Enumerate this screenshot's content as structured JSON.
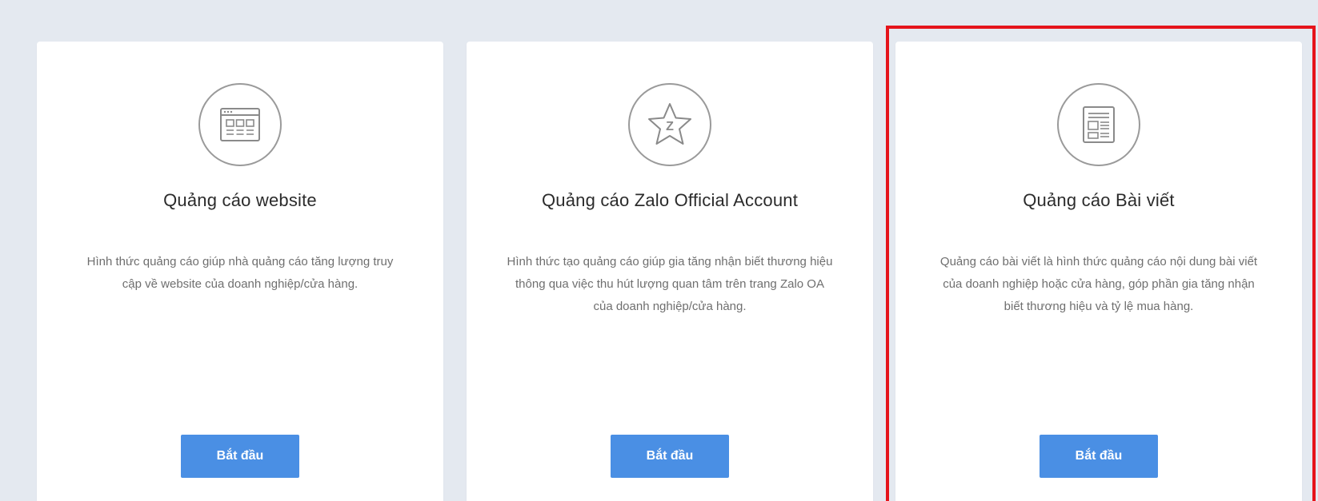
{
  "colors": {
    "page_background": "#e4e9f0",
    "card_background": "#ffffff",
    "button": "#4a8fe4",
    "highlight": "#e5141b"
  },
  "cards": [
    {
      "icon": "website-grid-icon",
      "title": "Quảng cáo website",
      "description": "Hình thức quảng cáo giúp nhà quảng cáo tăng lượng truy cập về website của doanh nghiệp/cửa hàng.",
      "button_label": "Bắt đầu"
    },
    {
      "icon": "zalo-star-icon",
      "icon_letter": "Z",
      "title": "Quảng cáo Zalo Official Account",
      "description": "Hình thức tạo quảng cáo giúp gia tăng nhận biết thương hiệu thông qua việc thu hút lượng quan tâm trên trang Zalo OA của doanh nghiệp/cửa hàng.",
      "button_label": "Bắt đầu"
    },
    {
      "icon": "article-newspaper-icon",
      "title": "Quảng cáo Bài viết",
      "description": "Quảng cáo bài viết là hình thức quảng cáo nội dung bài viết của doanh nghiệp hoặc cửa hàng, góp phần gia tăng nhận biết thương hiệu và tỷ lệ mua hàng.",
      "button_label": "Bắt đầu",
      "highlighted": true
    }
  ]
}
